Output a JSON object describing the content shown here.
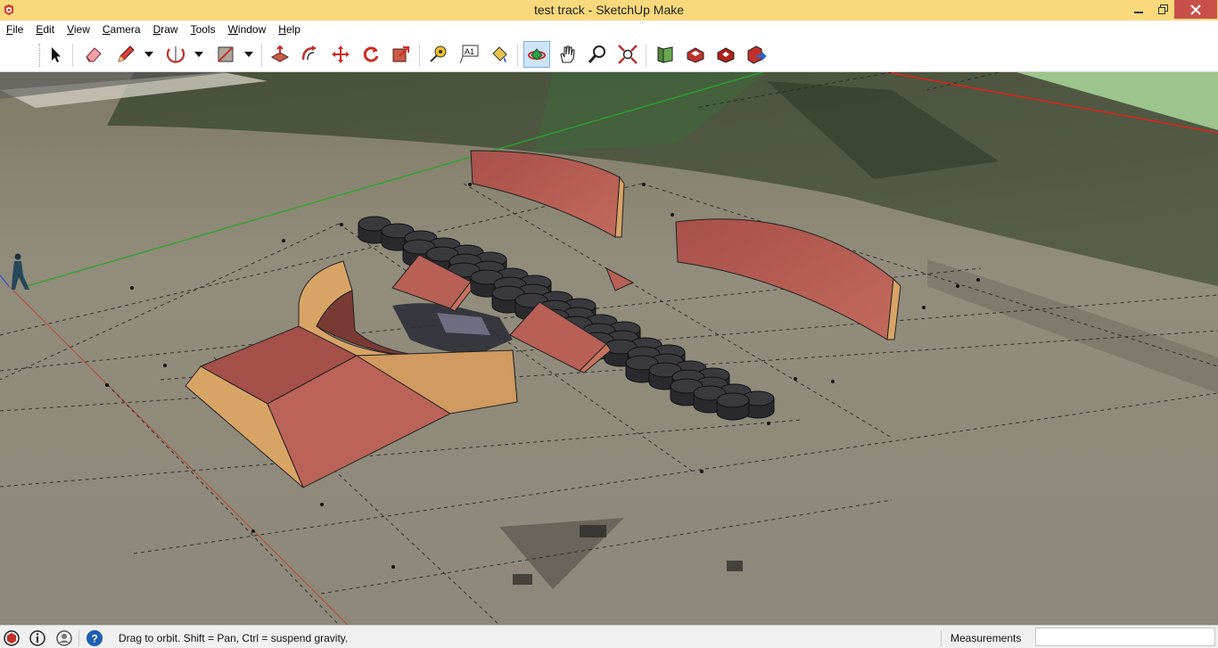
{
  "window": {
    "title": "test track - SketchUp Make"
  },
  "menu": [
    {
      "mnemonic": "F",
      "rest": "ile"
    },
    {
      "mnemonic": "E",
      "rest": "dit"
    },
    {
      "mnemonic": "V",
      "rest": "iew"
    },
    {
      "mnemonic": "C",
      "rest": "amera"
    },
    {
      "mnemonic": "D",
      "rest": "raw"
    },
    {
      "mnemonic": "T",
      "rest": "ools"
    },
    {
      "mnemonic": "W",
      "rest": "indow"
    },
    {
      "mnemonic": "H",
      "rest": "elp"
    }
  ],
  "toolbar": {
    "icons": [
      "select-icon",
      "eraser-icon",
      "pencil-line-icon",
      "arc-icon",
      "rectangle-icon",
      "push-pull-icon",
      "offset-icon",
      "move-icon",
      "rotate-icon",
      "scale-icon",
      "tape-measure-icon",
      "text-icon",
      "paint-bucket-icon",
      "orbit-icon",
      "pan-icon",
      "zoom-icon",
      "zoom-extents-icon",
      "add-location-icon",
      "3d-warehouse-icon",
      "extension-warehouse-icon",
      "share-model-icon"
    ],
    "active_tool": "orbit-icon",
    "text_tool_glyph": "A1"
  },
  "colors": {
    "titlebar": "#f9d97c",
    "close_button": "#c7504a",
    "accent_active": "#cfe3f7",
    "ramp_face": "#b86055",
    "ramp_side": "#d8a466",
    "tire": "#3a3a3e",
    "red_axis": "#e0241c",
    "green_axis": "#2aa52a"
  },
  "status": {
    "message": "Drag to orbit. Shift = Pan, Ctrl = suspend gravity.",
    "measurements_label": "Measurements",
    "measurements_value": ""
  }
}
